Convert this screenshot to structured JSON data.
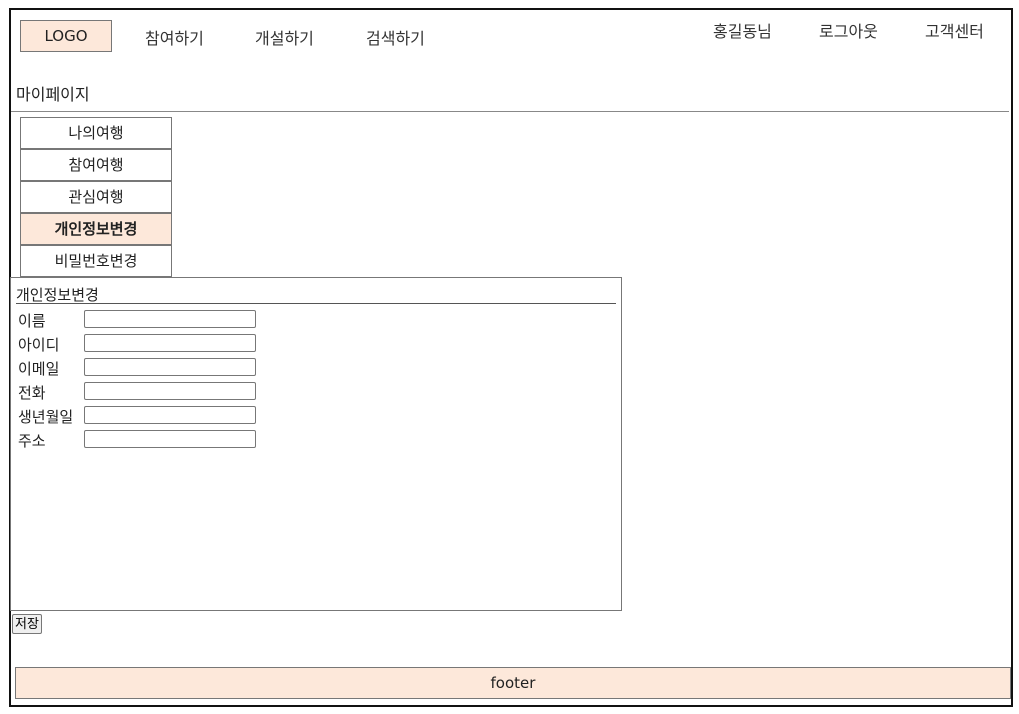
{
  "header": {
    "logo": "LOGO",
    "nav": [
      "참여하기",
      "개설하기",
      "검색하기"
    ],
    "user": "홍길동님",
    "logout": "로그아웃",
    "support": "고객센터"
  },
  "page_title": "마이페이지",
  "sidebar": {
    "items": [
      {
        "label": "나의여행",
        "active": false
      },
      {
        "label": "참여여행",
        "active": false
      },
      {
        "label": "관심여행",
        "active": false
      },
      {
        "label": "개인정보변경",
        "active": true
      },
      {
        "label": "비밀번호변경",
        "active": false
      }
    ]
  },
  "form": {
    "title": "개인정보변경",
    "fields": [
      {
        "label": "이름",
        "value": ""
      },
      {
        "label": "아이디",
        "value": ""
      },
      {
        "label": "이메일",
        "value": ""
      },
      {
        "label": "전화",
        "value": ""
      },
      {
        "label": "생년월일",
        "value": ""
      },
      {
        "label": "주소",
        "value": ""
      }
    ],
    "save_label": "저장"
  },
  "footer": "footer",
  "colors": {
    "accent": "#fde8da",
    "border": "#777777"
  }
}
